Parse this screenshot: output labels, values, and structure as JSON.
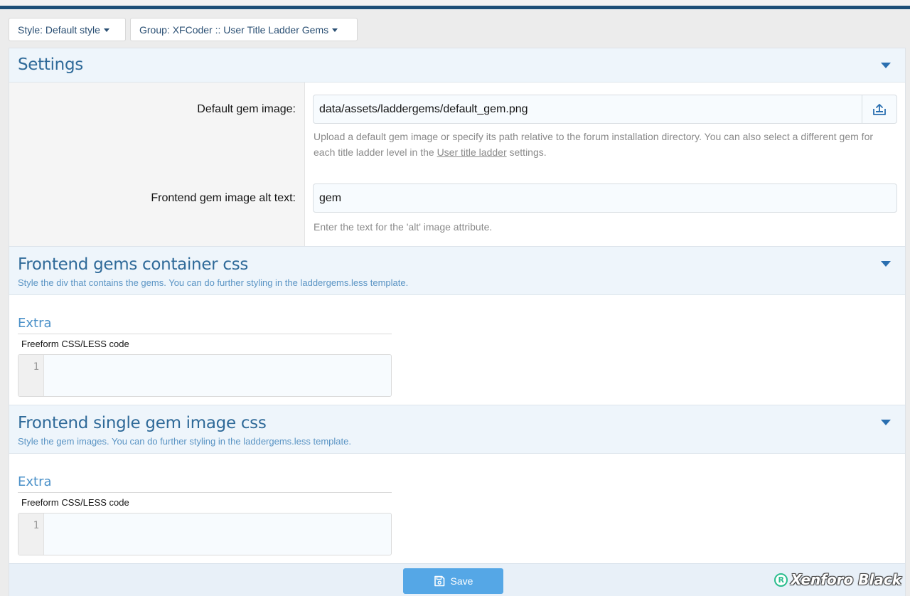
{
  "filters": {
    "style_label": "Style: Default style",
    "group_label": "Group: XFCoder :: User Title Ladder Gems"
  },
  "settings": {
    "title": "Settings",
    "default_gem": {
      "label": "Default gem image:",
      "value": "data/assets/laddergems/default_gem.png",
      "hint_before": "Upload a default gem image or specify its path relative to the forum installation directory. You can also select a different gem for each title ladder level in the ",
      "hint_link": "User title ladder",
      "hint_after": " settings."
    },
    "alt_text": {
      "label": "Frontend gem image alt text:",
      "value": "gem",
      "hint": "Enter the text for the 'alt' image attribute."
    }
  },
  "container_css": {
    "title": "Frontend gems container css",
    "description": "Style the div that contains the gems. You can do further styling in the laddergems.less template.",
    "extra_label": "Extra",
    "code_caption": "Freeform CSS/LESS code",
    "line_number": "1"
  },
  "single_css": {
    "title": "Frontend single gem image css",
    "description": "Style the gem images. You can do further styling in the laddergems.less template.",
    "extra_label": "Extra",
    "code_caption": "Freeform CSS/LESS code",
    "line_number": "1"
  },
  "footer": {
    "save_label": "Save"
  },
  "watermark": {
    "mark": "R",
    "text": "Xenforo Black"
  },
  "icons": {
    "filter_caret": "caret-down-icon",
    "section_toggle": "chevron-down-icon",
    "upload": "upload-icon",
    "save": "floppy-disk-icon"
  },
  "colors": {
    "topbar": "#1d4f77",
    "section_title": "#2f6a99",
    "accent": "#55a7e6",
    "section_bg": "#eef5fb"
  }
}
